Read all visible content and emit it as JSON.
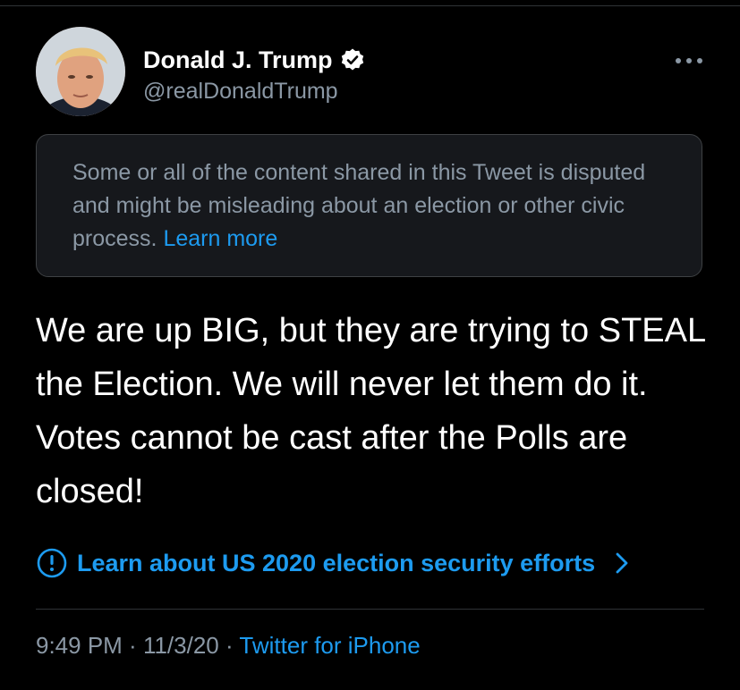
{
  "author": {
    "display_name": "Donald J. Trump",
    "handle": "@realDonaldTrump",
    "verified": true
  },
  "more_icon": "ellipsis-icon",
  "notice": {
    "text": "Some or all of the content shared in this Tweet is disputed and might be misleading about an election or other civic process. ",
    "link": "Learn more"
  },
  "tweet": {
    "text": "We are up BIG, but they are trying to STEAL the Election. We will never let them do it. Votes cannot be cast after the Polls are closed!"
  },
  "security_link": {
    "label": "Learn about US 2020 election security efforts",
    "icon": "exclamation-circle-icon",
    "chevron": "chevron-right-icon"
  },
  "meta": {
    "time": "9:49 PM",
    "separator": " · ",
    "date": "11/3/20",
    "source": "Twitter for iPhone"
  },
  "colors": {
    "background": "#000000",
    "link": "#1d9bf0",
    "muted": "#8b98a5",
    "text": "#ffffff"
  }
}
